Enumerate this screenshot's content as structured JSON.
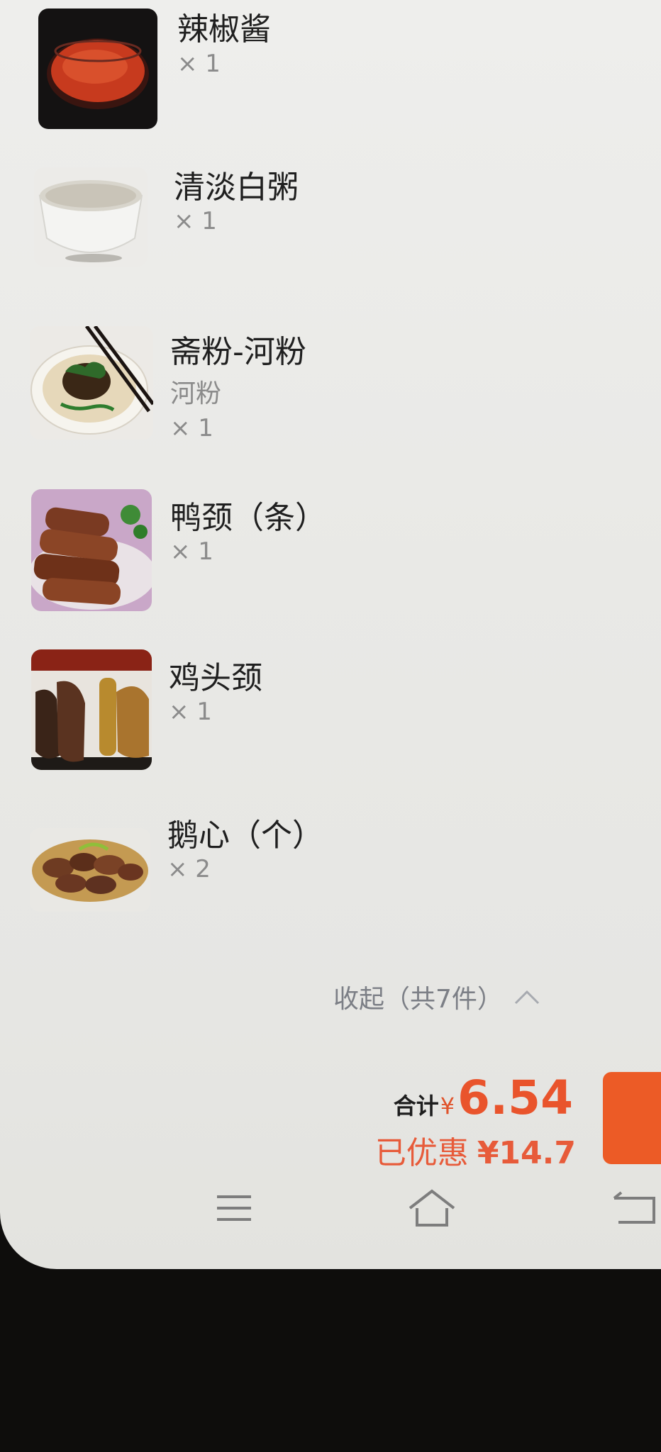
{
  "order_items": [
    {
      "name": "辣椒酱",
      "qty": "× 1",
      "icon": "chili-sauce-photo"
    },
    {
      "name": "清淡白粥",
      "qty": "× 1",
      "icon": "congee-photo"
    },
    {
      "name": "斋粉-河粉",
      "spec": "河粉",
      "qty": "× 1",
      "icon": "rice-noodle-photo"
    },
    {
      "name": "鸭颈（条）",
      "qty": "× 1",
      "icon": "duck-neck-photo"
    },
    {
      "name": "鸡头颈",
      "qty": "× 1",
      "icon": "chicken-neck-photo"
    },
    {
      "name": "鹅心（个）",
      "qty": "× 2",
      "icon": "goose-heart-photo"
    }
  ],
  "collapse": {
    "label": "收起（共7件）",
    "icon": "chevron-up-icon"
  },
  "summary": {
    "total_label": "合计",
    "currency": "¥",
    "total_amount": "6.54",
    "discount_label": "已优惠",
    "discount_amount": "¥14.7"
  },
  "colors": {
    "accent": "#e9542c",
    "checkout_button": "#ec5b26"
  },
  "navbar": {
    "icons": [
      "menu-icon",
      "home-icon",
      "back-icon"
    ]
  }
}
